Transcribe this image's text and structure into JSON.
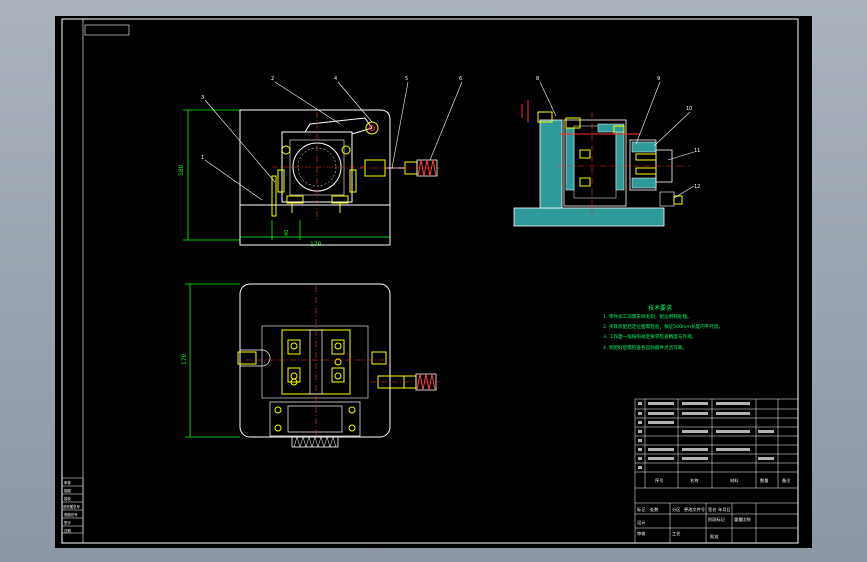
{
  "colors": {
    "background": "#000000",
    "frame": "#ffffff",
    "part_outline": "#ffffff",
    "fixture_fill": "#2f9a9a",
    "dimension": "#00ff00",
    "leader": "#ffffff",
    "centerline": "#ff2b2b",
    "spring": "#ff4040",
    "highlight_yellow": "#ffff00",
    "notes_text": "#00ff66"
  },
  "drawing": {
    "balloons_front": [
      "1",
      "2",
      "3",
      "4",
      "5",
      "6"
    ],
    "balloons_side": [
      "8",
      "9",
      "10",
      "11",
      "12"
    ],
    "dims_front": {
      "height": "180",
      "width": "170",
      "small": "40"
    },
    "dims_plan": {
      "height": "170"
    },
    "notes_title": "技术要求",
    "notes": [
      "1. 零件加工前需去除毛刺，锐边倒钝处理。",
      "2. 夹具装配后定位面需检验，保证500mm长度内平行度。",
      "3. 工作面一般按照规定要求检查精度与外观。",
      "4. 装配好后需检查各运动部件灵活可靠。"
    ]
  },
  "title_block": {
    "header_cells": [
      "序号",
      "名称",
      "材料",
      "数量",
      "备注"
    ],
    "footer_cells": [
      "标记",
      "处数",
      "分区",
      "更改文件号",
      "签名",
      "年月日"
    ],
    "footer_cells_right": [
      "阶段标记",
      "重量",
      "比例"
    ],
    "bottom_cells": [
      "设计",
      "审核",
      "工艺",
      "批准"
    ]
  },
  "side_block": [
    "审核",
    "描图",
    "描校",
    "旧底图总号",
    "底图总号",
    "签字",
    "日期"
  ]
}
